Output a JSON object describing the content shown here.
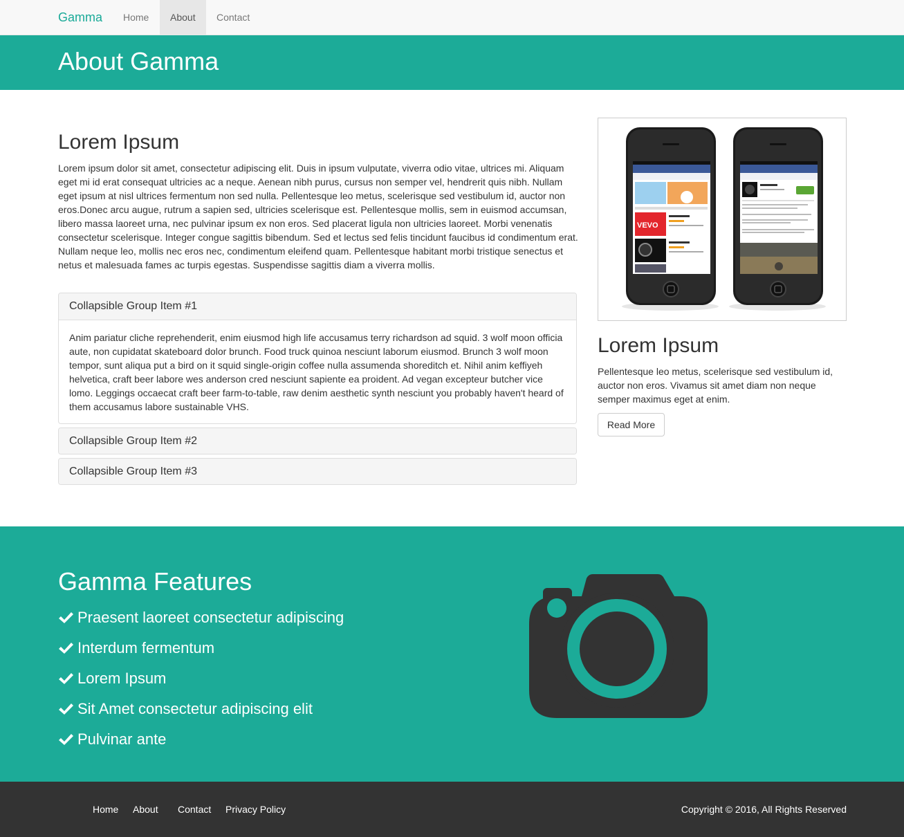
{
  "navbar": {
    "brand": "Gamma",
    "links": [
      {
        "label": "Home",
        "active": false
      },
      {
        "label": "About",
        "active": true
      },
      {
        "label": "Contact",
        "active": false
      }
    ]
  },
  "header": {
    "title": "About Gamma"
  },
  "main": {
    "title": "Lorem Ipsum",
    "paragraph": "Lorem ipsum dolor sit amet, consectetur adipiscing elit. Duis in ipsum vulputate, viverra odio vitae, ultrices mi. Aliquam eget mi id erat consequat ultricies ac a neque. Aenean nibh purus, cursus non semper vel, hendrerit quis nibh. Nullam eget ipsum at nisl ultrices fermentum non sed nulla. Pellentesque leo metus, scelerisque sed vestibulum id, auctor non eros.Donec arcu augue, rutrum a sapien sed, ultricies scelerisque est. Pellentesque mollis, sem in euismod accumsan, libero massa laoreet urna, nec pulvinar ipsum ex non eros. Sed placerat ligula non ultricies laoreet. Morbi venenatis consectetur scelerisque. Integer congue sagittis bibendum. Sed et lectus sed felis tincidunt faucibus id condimentum erat. Nullam neque leo, mollis nec eros nec, condimentum eleifend quam. Pellentesque habitant morbi tristique senectus et netus et malesuada fames ac turpis egestas. Suspendisse sagittis diam a viverra mollis.",
    "accordion": [
      {
        "title": "Collapsible Group Item #1",
        "expanded": true,
        "body": "Anim pariatur cliche reprehenderit, enim eiusmod high life accusamus terry richardson ad squid. 3 wolf moon officia aute, non cupidatat skateboard dolor brunch. Food truck quinoa nesciunt laborum eiusmod. Brunch 3 wolf moon tempor, sunt aliqua put a bird on it squid single-origin coffee nulla assumenda shoreditch et. Nihil anim keffiyeh helvetica, craft beer labore wes anderson cred nesciunt sapiente ea proident. Ad vegan excepteur butcher vice lomo. Leggings occaecat craft beer farm-to-table, raw denim aesthetic synth nesciunt you probably haven't heard of them accusamus labore sustainable VHS."
      },
      {
        "title": "Collapsible Group Item #2",
        "expanded": false
      },
      {
        "title": "Collapsible Group Item #3",
        "expanded": false
      }
    ]
  },
  "sidebar": {
    "image_alt": "two smartphones showing app store screens",
    "title": "Lorem Ipsum",
    "paragraph": "Pellentesque leo metus, scelerisque sed vestibulum id, auctor non eros. Vivamus sit amet diam non neque semper maximus eget at enim.",
    "button_label": "Read More"
  },
  "features": {
    "title": "Gamma Features",
    "items": [
      "Praesent laoreet consectetur adipiscing",
      "Interdum fermentum",
      "Lorem Ipsum",
      "Sit Amet consectetur adipiscing elit",
      "Pulvinar ante"
    ],
    "icon": "camera-icon"
  },
  "footer": {
    "links": [
      "Home",
      "About",
      "Contact",
      "Privacy Policy"
    ],
    "copyright": "Copyright © 2016, All Rights Reserved"
  },
  "colors": {
    "accent": "#1cab98",
    "brand": "#1aaa98",
    "footer": "#333333",
    "camera": "#333333"
  }
}
